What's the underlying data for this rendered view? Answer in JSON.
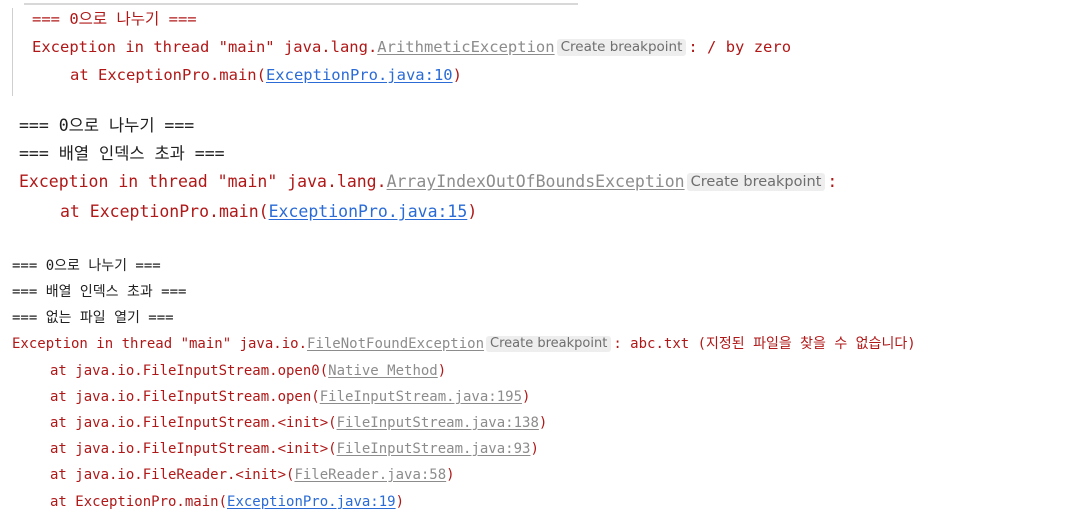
{
  "panel1": {
    "line1": "=== 0으로 나누기 ===",
    "exc_prefix": "Exception in thread \"main\" java.lang.",
    "exc_class": "ArithmeticException",
    "breakpoint": "Create breakpoint",
    "exc_suffix": ": / by zero",
    "at_prefix": "at ExceptionPro.main(",
    "at_link": "ExceptionPro.java:10",
    "at_suffix": ")"
  },
  "panel2": {
    "line1": "=== 0으로 나누기 ===",
    "line2": "=== 배열 인덱스 초과 ===",
    "exc_prefix": "Exception in thread \"main\" java.lang.",
    "exc_class": "ArrayIndexOutOfBoundsException",
    "breakpoint": "Create breakpoint",
    "exc_suffix": ":",
    "at_prefix": "at ExceptionPro.main(",
    "at_link": "ExceptionPro.java:15",
    "at_suffix": ")"
  },
  "panel3": {
    "line1": "=== 0으로 나누기 ===",
    "line2": "=== 배열 인덱스 초과 ===",
    "line3": "=== 없는 파일 열기 ===",
    "exc_prefix": "Exception in thread \"main\" java.io.",
    "exc_class": "FileNotFoundException",
    "breakpoint": "Create breakpoint",
    "exc_suffix": ": abc.txt (지정된 파일을 찾을 수 없습니다)",
    "stack": [
      {
        "prefix": "at java.io.FileInputStream.open0(",
        "link": "Native Method",
        "suffix": ")"
      },
      {
        "prefix": "at java.io.FileInputStream.open(",
        "link": "FileInputStream.java:195",
        "suffix": ")"
      },
      {
        "prefix": "at java.io.FileInputStream.<init>(",
        "link": "FileInputStream.java:138",
        "suffix": ")"
      },
      {
        "prefix": "at java.io.FileInputStream.<init>(",
        "link": "FileInputStream.java:93",
        "suffix": ")"
      },
      {
        "prefix": "at java.io.FileReader.<init>(",
        "link": "FileReader.java:58",
        "suffix": ")"
      },
      {
        "prefix": "at ExceptionPro.main(",
        "link": "ExceptionPro.java:19",
        "suffix": ")"
      }
    ]
  },
  "colors": {
    "error_text": "#b01818",
    "link_blue": "#2a6bd6",
    "link_gray": "#8c8c8c",
    "breakpoint_bg": "#eeeeee"
  }
}
